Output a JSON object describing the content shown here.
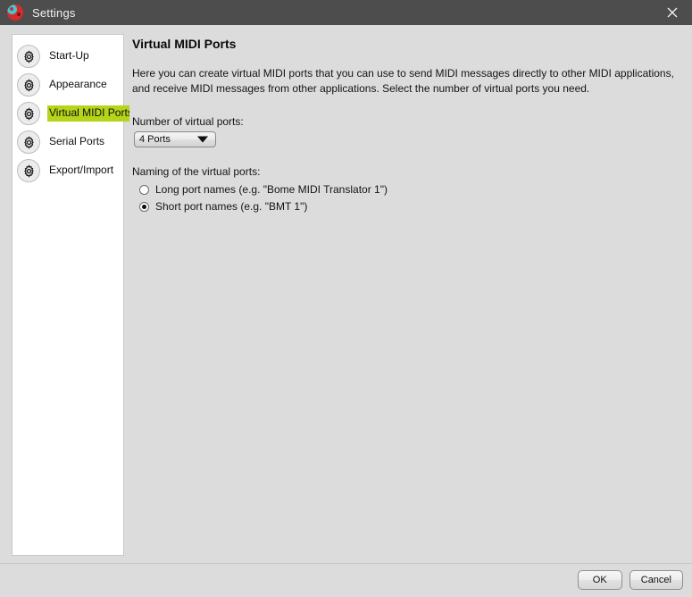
{
  "window": {
    "title": "Settings",
    "app_icon": "bome-logo-icon",
    "close_icon": "close-icon",
    "titlebar_color": "#4d4d4d",
    "background_color": "#dcdcdc"
  },
  "sidebar": {
    "items": [
      {
        "label": "Start-Up",
        "icon": "gear-icon",
        "selected": false
      },
      {
        "label": "Appearance",
        "icon": "gear-icon",
        "selected": false
      },
      {
        "label": "Virtual MIDI Ports",
        "icon": "gear-icon",
        "selected": true
      },
      {
        "label": "Serial Ports",
        "icon": "gear-icon",
        "selected": false
      },
      {
        "label": "Export/Import",
        "icon": "gear-icon",
        "selected": false
      }
    ],
    "highlight_color": "#b5d519"
  },
  "main": {
    "title": "Virtual MIDI Ports",
    "description": "Here you can create virtual MIDI ports that you can use to send MIDI messages directly to other MIDI applications, and receive MIDI messages from other applications. Select the number of virtual ports you need.",
    "ports_label": "Number of virtual ports:",
    "ports_dropdown": {
      "value": "4 Ports",
      "arrow_icon": "chevron-down-icon"
    },
    "naming_label": "Naming of the virtual ports:",
    "naming_options": [
      {
        "label": "Long port names (e.g. \"Bome MIDI Translator 1\")",
        "selected": false
      },
      {
        "label": "Short port names (e.g. \"BMT 1\")",
        "selected": true
      }
    ]
  },
  "footer": {
    "ok_label": "OK",
    "cancel_label": "Cancel"
  }
}
